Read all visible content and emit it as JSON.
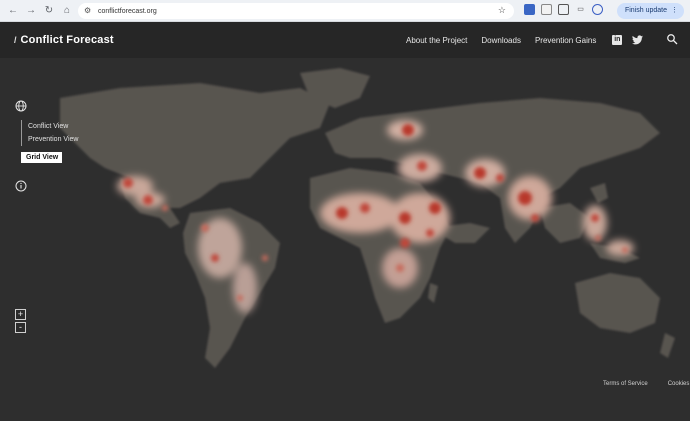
{
  "browser": {
    "url": "conflictforecast.org",
    "finish_update_label": "Finish update"
  },
  "header": {
    "brand_slash": "/",
    "title": "Conflict Forecast",
    "nav": [
      "About the Project",
      "Downloads",
      "Prevention Gains"
    ],
    "linkedin_label": "in"
  },
  "map": {
    "views": [
      "Conflict View",
      "Prevention View",
      "Grid View"
    ],
    "active_view": "Grid View",
    "zoom_in": "+",
    "zoom_out": "-"
  },
  "footer": {
    "terms": "Terms of Service",
    "cookies": "Cookies"
  }
}
